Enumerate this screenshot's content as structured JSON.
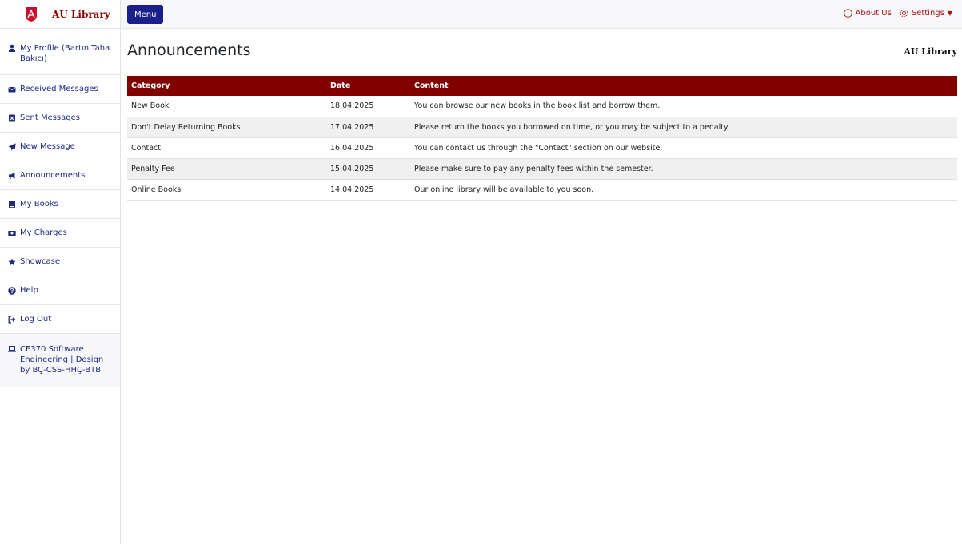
{
  "brand": {
    "name": "AU Library"
  },
  "sidebar": {
    "items": [
      {
        "label": "My Profile (Bartın Taha Bakıcı)",
        "icon": "user-icon"
      },
      {
        "label": "Received Messages",
        "icon": "envelope-icon"
      },
      {
        "label": "Sent Messages",
        "icon": "sent-box-icon"
      },
      {
        "label": "New Message",
        "icon": "paper-plane-icon"
      },
      {
        "label": "Announcements",
        "icon": "megaphone-icon"
      },
      {
        "label": "My Books",
        "icon": "book-icon"
      },
      {
        "label": "My Charges",
        "icon": "money-icon"
      },
      {
        "label": "Showcase",
        "icon": "star-icon"
      },
      {
        "label": "Help",
        "icon": "question-icon"
      },
      {
        "label": "Log Out",
        "icon": "logout-icon"
      }
    ],
    "footer": {
      "label": "CE370 Software Engineering | Design by BÇ-CSS-HHÇ-BTB",
      "icon": "laptop-icon"
    }
  },
  "topbar": {
    "menu_label": "Menu",
    "about_label": "About Us",
    "settings_label": "Settings"
  },
  "page": {
    "title": "Announcements",
    "brand": "AU Library"
  },
  "table": {
    "headers": [
      "Category",
      "Date",
      "Content"
    ],
    "rows": [
      [
        "New Book",
        "18.04.2025",
        "You can browse our new books in the book list and borrow them."
      ],
      [
        "Don't Delay Returning Books",
        "17.04.2025",
        "Please return the books you borrowed on time, or you may be subject to a penalty."
      ],
      [
        "Contact",
        "16.04.2025",
        "You can contact us through the \"Contact\" section on our website."
      ],
      [
        "Penalty Fee",
        "15.04.2025",
        "Please make sure to pay any penalty fees within the semester."
      ],
      [
        "Online Books",
        "14.04.2025",
        "Our online library will be available to you soon."
      ]
    ]
  },
  "colors": {
    "accent": "#1a1f8a",
    "header_bg": "#800000",
    "link": "#a11515"
  }
}
